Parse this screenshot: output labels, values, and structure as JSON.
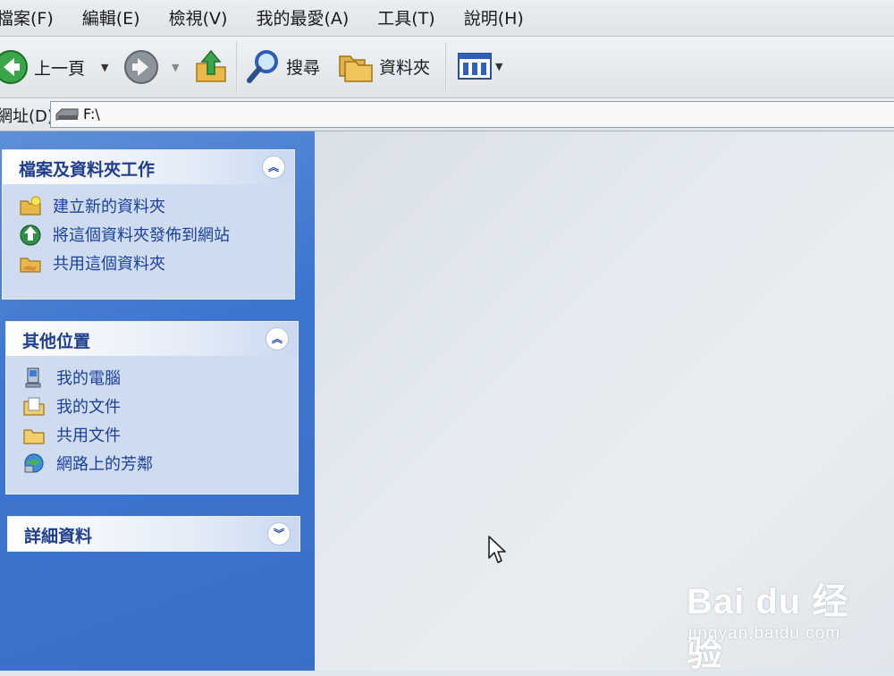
{
  "menu": [
    "檔案(F)",
    "編輯(E)",
    "檢視(V)",
    "我的最愛(A)",
    "工具(T)",
    "說明(H)"
  ],
  "toolbar": {
    "back_label": "上一頁",
    "search_label": "搜尋",
    "folders_label": "資料夾"
  },
  "address": {
    "label": "網址(D)",
    "value": "F:\\"
  },
  "panels": {
    "file_tasks": {
      "title": "檔案及資料夾工作",
      "items": [
        "建立新的資料夾",
        "將這個資料夾發佈到網站",
        "共用這個資料夾"
      ]
    },
    "other_places": {
      "title": "其他位置",
      "items": [
        "我的電腦",
        "我的文件",
        "共用文件",
        "網路上的芳鄰"
      ]
    },
    "details": {
      "title": "詳細資料"
    }
  },
  "watermark": {
    "main": "Bai du 经验",
    "sub": "jingyan.baidu.com"
  },
  "colors": {
    "task_pane": "#3d76d1",
    "panel_title": "#1f3e8c",
    "task_link": "#1b3f9a"
  }
}
